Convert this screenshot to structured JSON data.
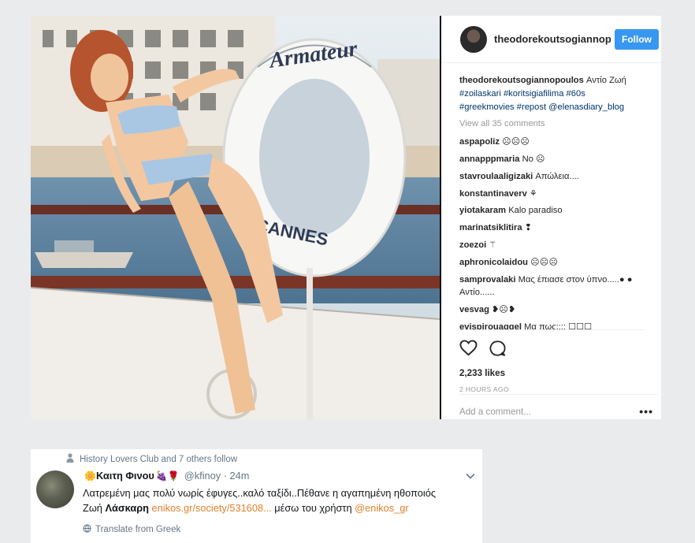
{
  "instagram": {
    "photo": {
      "buoy_text_top": "Armateur",
      "buoy_text_bottom": "CANNES"
    },
    "username": "theodorekoutsogiannopoulos",
    "username_header": "theodorekoutsogiannop",
    "follow_label": "Follow",
    "caption": {
      "text": "Αντίο Ζωή",
      "tags_line1": "#zoilaskari #koritsigiafilima #60s",
      "tags_line2": "#greekmovies #repost @elenasdiary_blog"
    },
    "view_all": "View all 35 comments",
    "comments": [
      {
        "user": "aspapoliz",
        "text": "☹☹☹"
      },
      {
        "user": "annapppmaria",
        "text": "No ☹"
      },
      {
        "user": "stavroulaaligizaki",
        "text": "Απώλεια...."
      },
      {
        "user": "konstantinaverv",
        "text": "⚘"
      },
      {
        "user": "yiotakaram",
        "text": "Kalo paradiso"
      },
      {
        "user": "marinatsiklitira",
        "text": "❢"
      },
      {
        "user": "zoezoi",
        "text": "⚚"
      },
      {
        "user": "aphronicolaidou",
        "text": "☹☹☹"
      },
      {
        "user": "samprovalaki",
        "text": "Μας έπιασε στον ύπνο.....● ● Αντίο......"
      },
      {
        "user": "vesvag",
        "text": "❥☹❥"
      },
      {
        "user": "evispirouaggel",
        "text": "Μα πως;;;; ☐☐☐"
      }
    ],
    "likes": "2,233 likes",
    "time": "2 HOURS AGO",
    "add_comment_placeholder": "Add a comment...",
    "more_label": "•••"
  },
  "tweet": {
    "context": "History Lovers Club and 7 others follow",
    "name": "Καιτη Φινου",
    "name_emoji_before": "🌼",
    "name_emoji_after": "🍇🌹",
    "handle": "@kfinoy · 24m",
    "text_line1": "Λατρεμένη μας πολύ νωρίς έφυγες..καλό ταξίδι..Πέθανε η αγαπημένη ηθοποιός",
    "text_pre": "Ζωή ",
    "text_bold": "Λάσκαρη",
    "text_space": " ",
    "link": "enikos.gr/society/531608...",
    "text_mid": " μέσω του χρήστη ",
    "mention": "@enikos_gr",
    "translate": "Translate from Greek"
  },
  "colors": {
    "follow_button": "#3897f0",
    "page_background": "#e9ebed",
    "tweet_link": "#e0812a",
    "hashtag": "#003569"
  }
}
